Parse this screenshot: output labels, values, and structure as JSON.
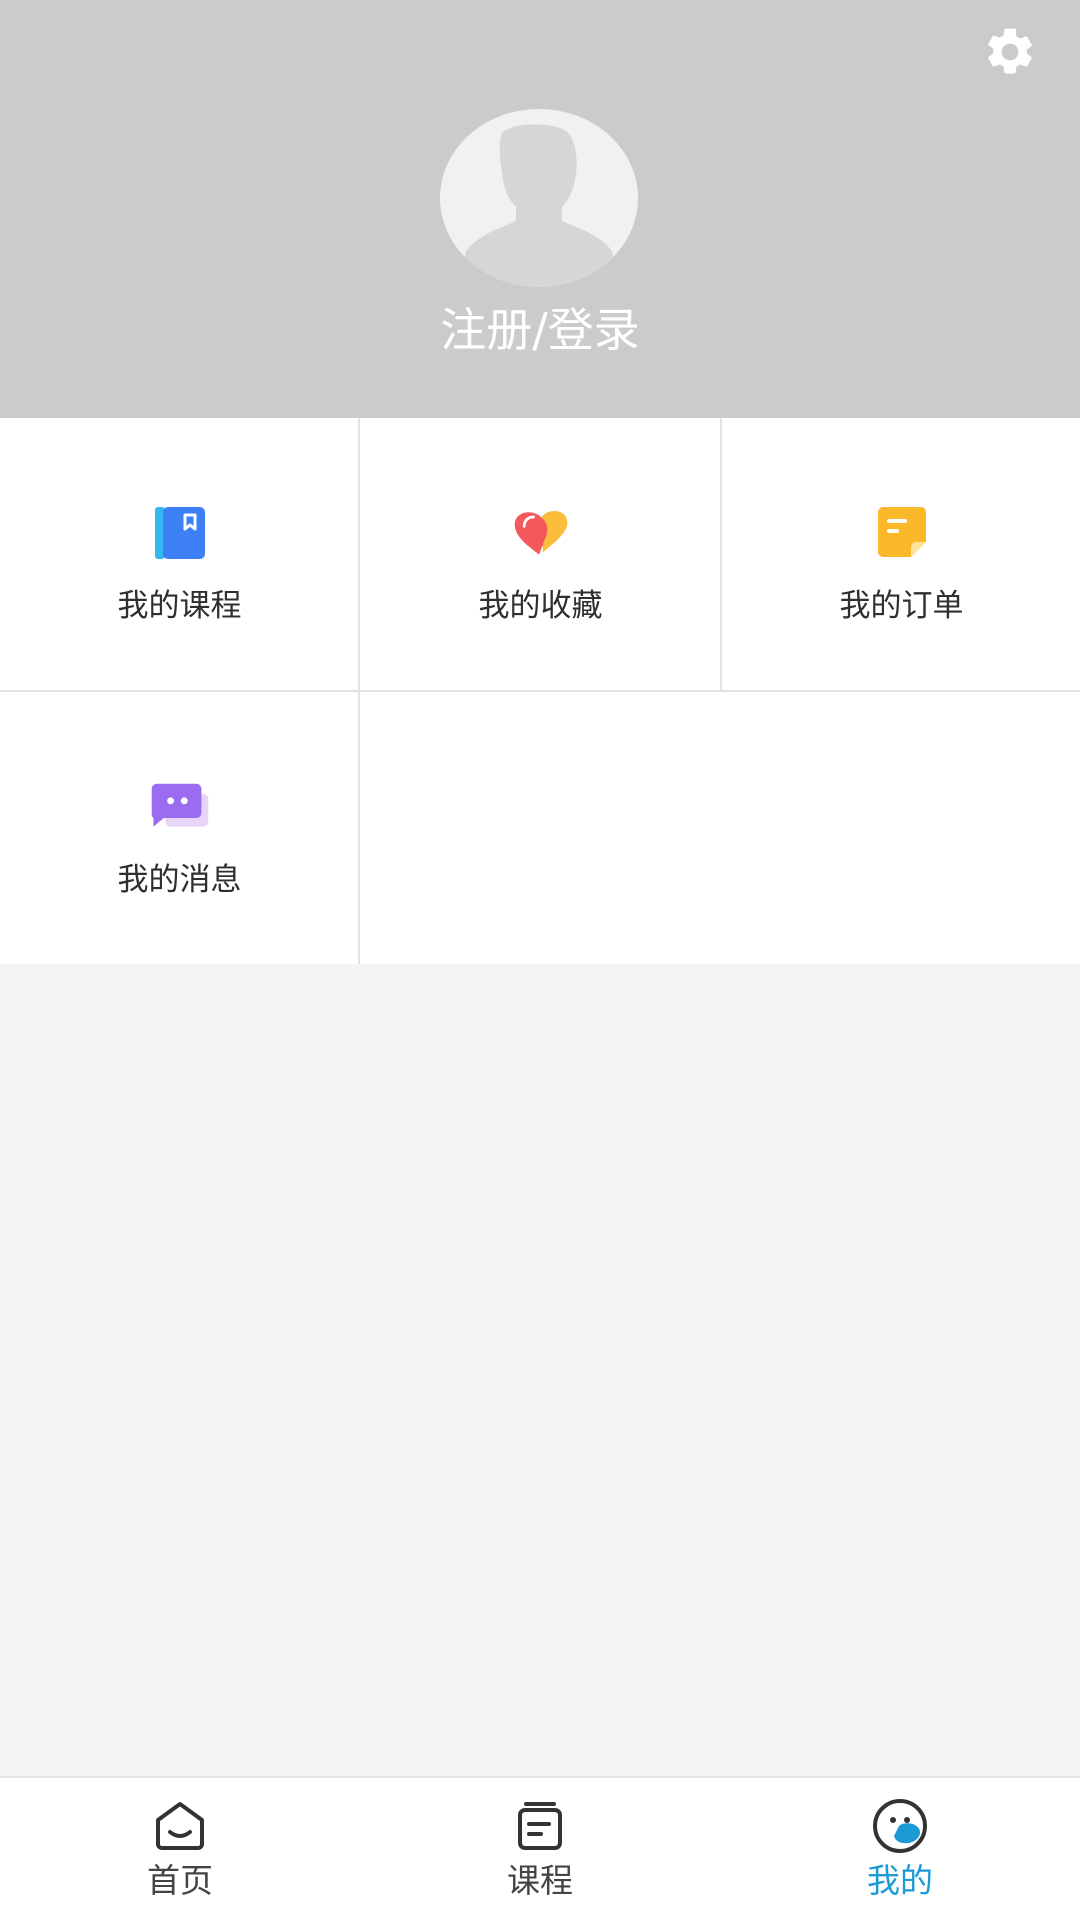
{
  "header": {
    "login_label": "注册/登录",
    "settings_icon": "gear-icon",
    "avatar_icon": "default-avatar-icon"
  },
  "menu": {
    "items": [
      {
        "label": "我的课程",
        "icon": "book-icon",
        "color": "#3d7ff5"
      },
      {
        "label": "我的收藏",
        "icon": "heart-tag-icon",
        "color": "#f2585c"
      },
      {
        "label": "我的订单",
        "icon": "note-icon",
        "color": "#fbb829"
      },
      {
        "label": "我的消息",
        "icon": "chat-bubble-icon",
        "color": "#9b6bf0"
      }
    ]
  },
  "tabbar": {
    "tabs": [
      {
        "label": "首页",
        "icon": "home-icon",
        "active": false
      },
      {
        "label": "课程",
        "icon": "course-icon",
        "active": false
      },
      {
        "label": "我的",
        "icon": "profile-face-icon",
        "active": true
      }
    ],
    "active_color": "#1c9ad6"
  }
}
